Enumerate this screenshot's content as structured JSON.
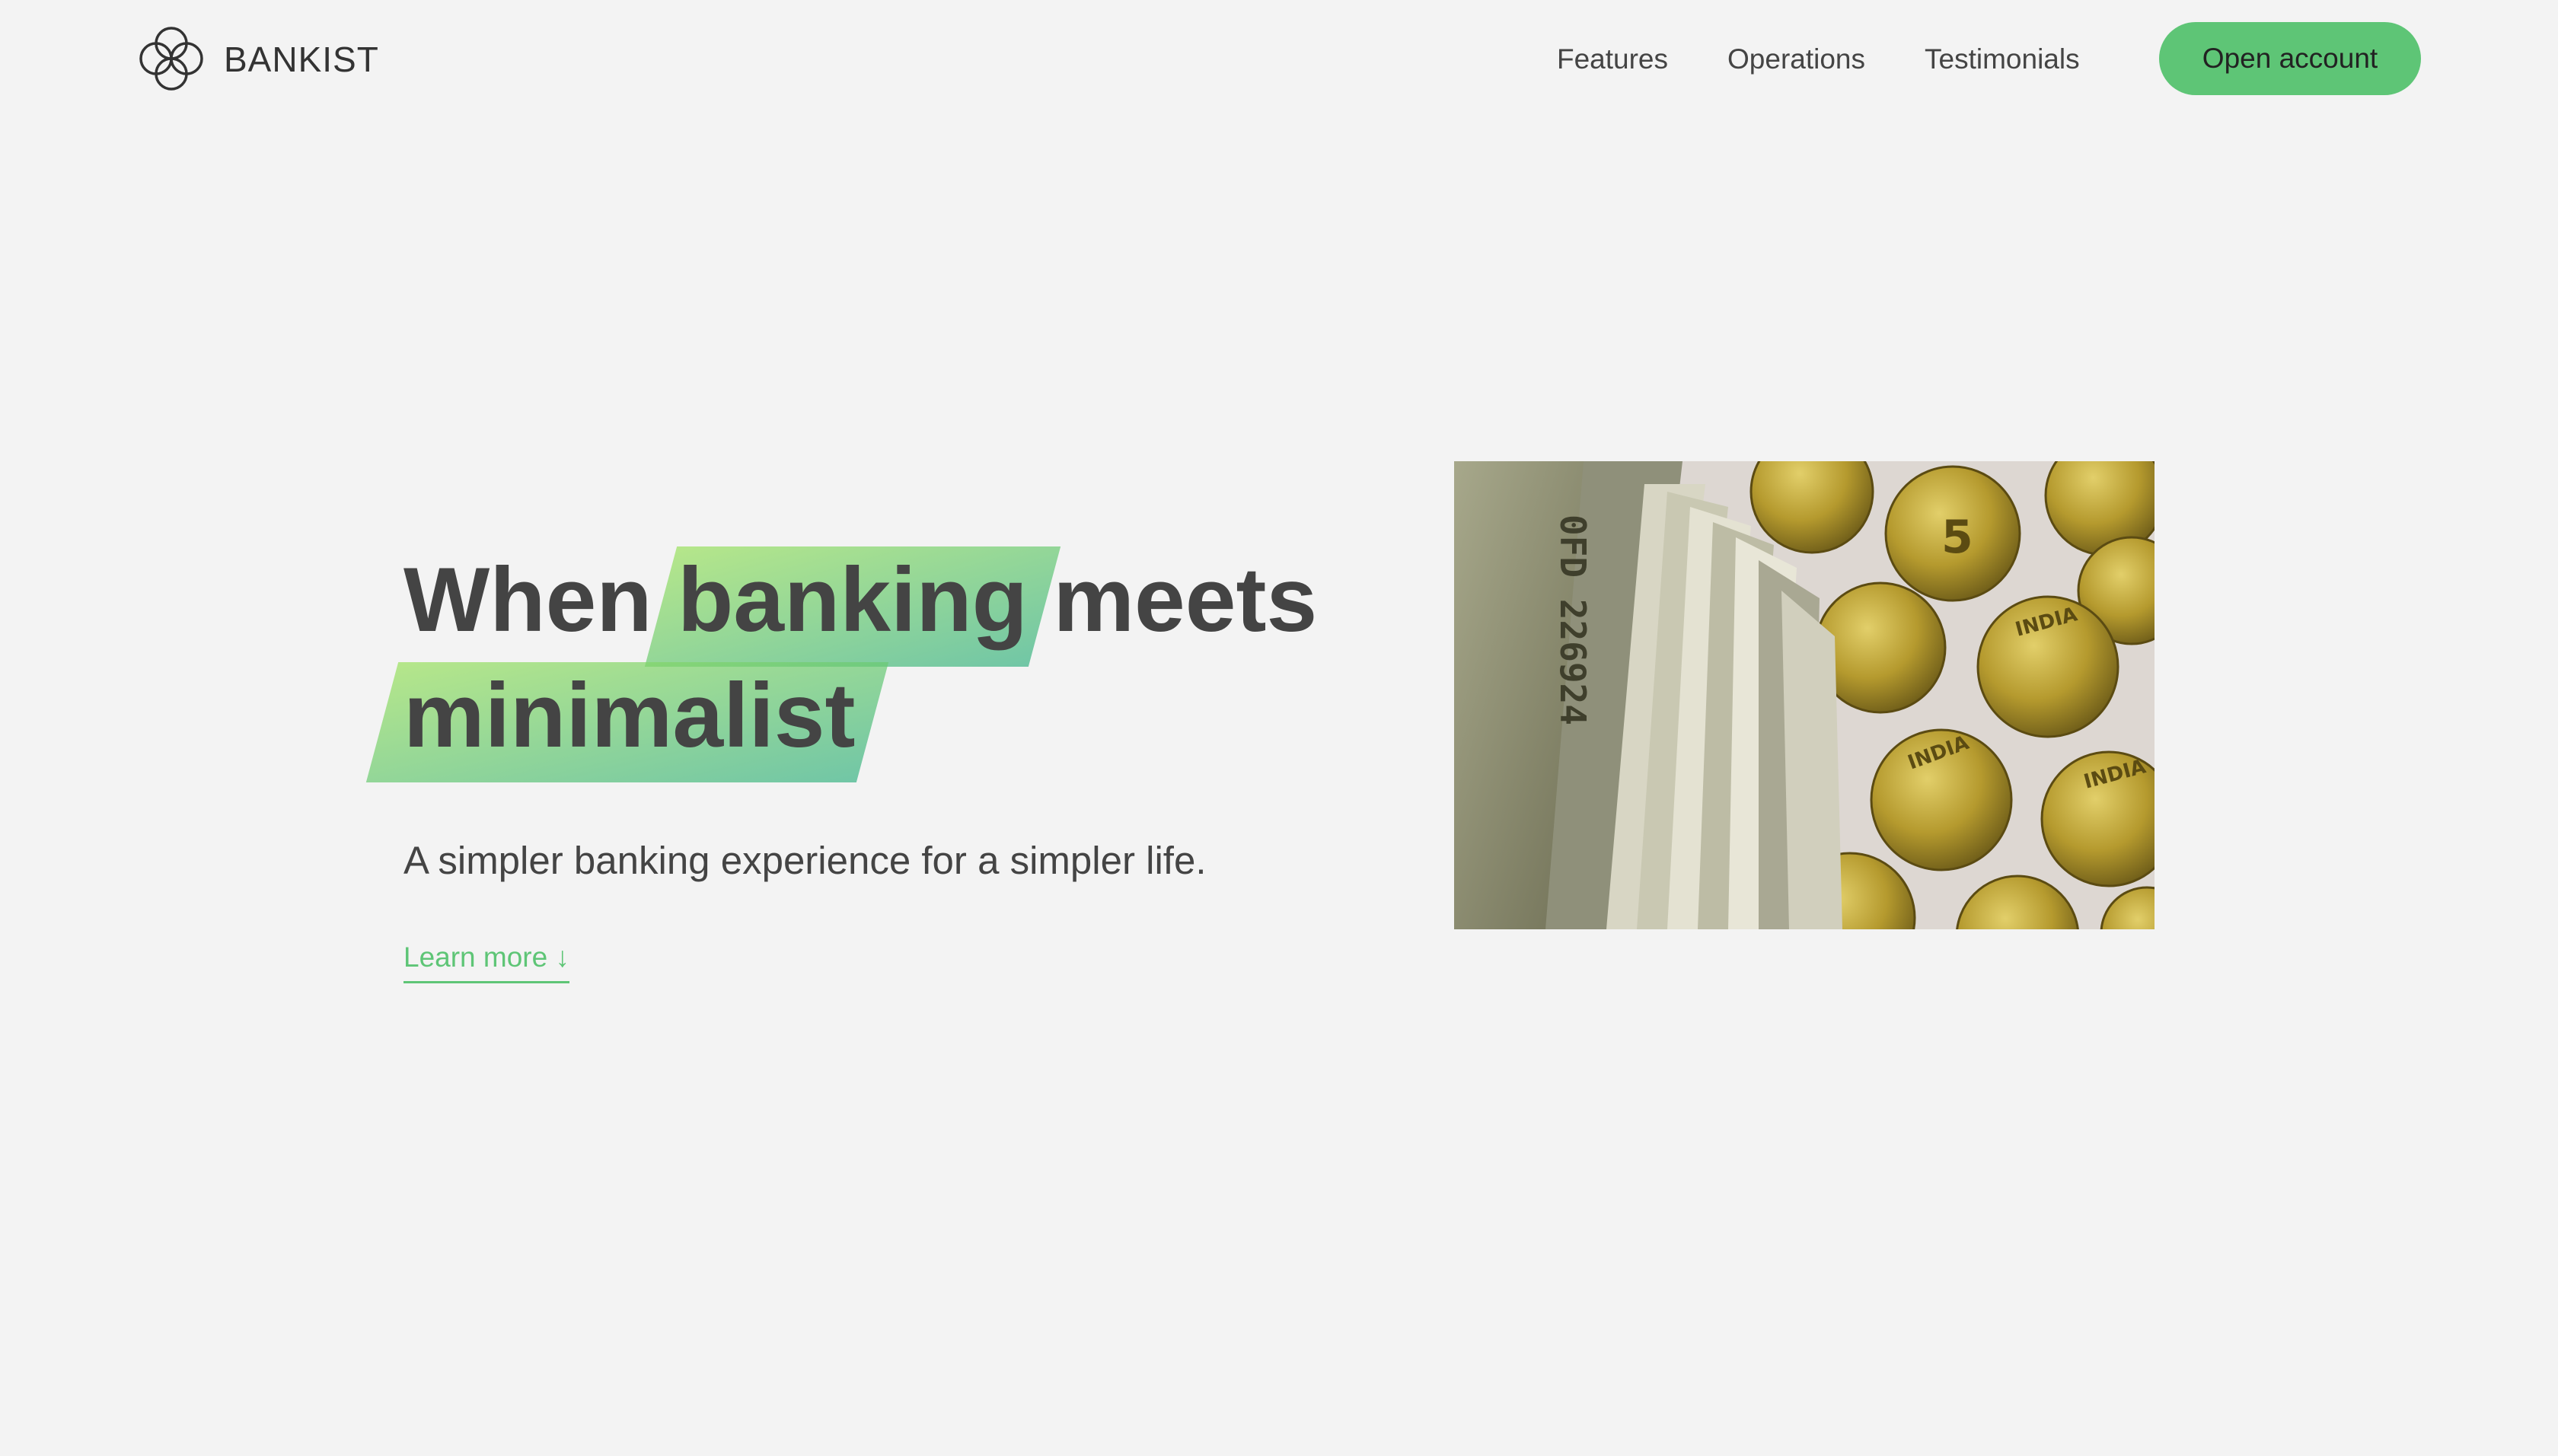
{
  "nav": {
    "brand": "BANKIST",
    "logo_icon": "bankist-logo-icon",
    "links": [
      {
        "label": "Features"
      },
      {
        "label": "Operations"
      },
      {
        "label": "Testimonials"
      }
    ],
    "cta_label": "Open account"
  },
  "hero": {
    "title_word1": "When",
    "title_highlight1": "banking",
    "title_word2": "meets",
    "title_highlight2": "minimalist",
    "subtitle": "A simpler banking experience for a simpler life.",
    "learn_more": "Learn more ↓",
    "image_description": "Banknotes and gold coins",
    "image_text": {
      "note_serial": "0FD 226924",
      "coin_label": "INDIA",
      "coin_value": "5"
    }
  },
  "colors": {
    "background": "#f3f3f3",
    "accent": "#5ec576",
    "text": "#444444",
    "highlight_gradient_from": "#9be15d",
    "highlight_gradient_to": "#39b385"
  }
}
